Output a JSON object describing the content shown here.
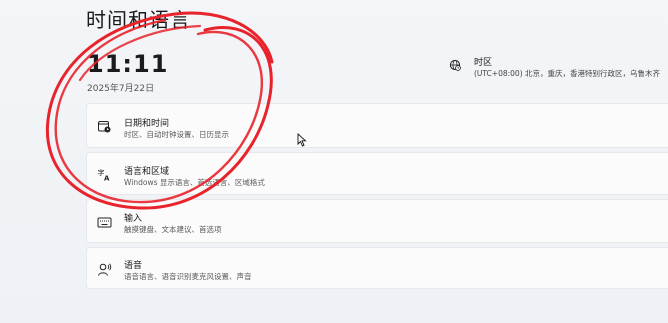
{
  "page": {
    "title": "时间和语言"
  },
  "clock": {
    "time": "11:11",
    "date": "2025年7月22日"
  },
  "timezone": {
    "label": "时区",
    "value": "(UTC+08:00) 北京，重庆，香港特别行政区，乌鲁木齐"
  },
  "cards": [
    {
      "title": "日期和时间",
      "subtitle": "时区、自动时钟设置、日历显示",
      "icon": "calendar-clock-icon"
    },
    {
      "title": "语言和区域",
      "subtitle": "Windows 显示语言、首选语言、区域格式",
      "icon": "language-icon"
    },
    {
      "title": "输入",
      "subtitle": "触摸键盘、文本建议、首选项",
      "icon": "keyboard-icon"
    },
    {
      "title": "语音",
      "subtitle": "语音语言、语音识别麦克风设置、声音",
      "icon": "speech-icon"
    }
  ],
  "colors": {
    "annotation": "#e8232b",
    "card_bg": "#fbfbfb",
    "page_bg": "#f3f5f8"
  }
}
